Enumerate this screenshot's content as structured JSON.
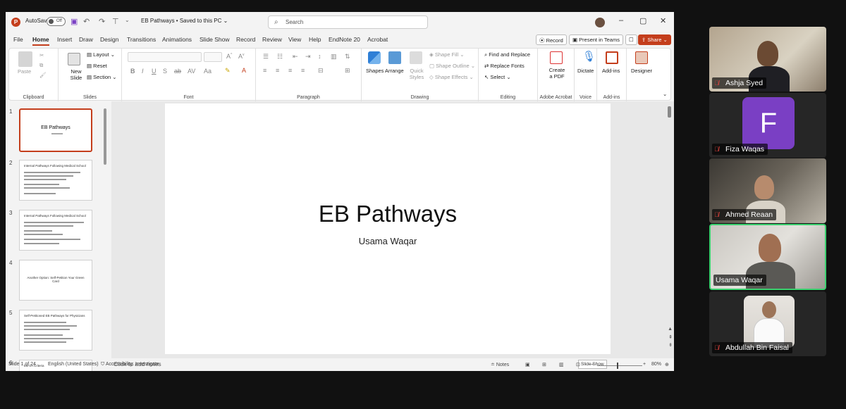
{
  "window": {
    "autosave_label": "AutoSave",
    "autosave_state": "Off",
    "doc_title": "EB Pathways • Saved to this PC ⌄",
    "search_placeholder": "Search"
  },
  "menu": {
    "tabs": [
      "File",
      "Home",
      "Insert",
      "Draw",
      "Design",
      "Transitions",
      "Animations",
      "Slide Show",
      "Record",
      "Review",
      "View",
      "Help",
      "EndNote 20",
      "Acrobat"
    ],
    "active_tab": "Home",
    "record_label": "Record",
    "present_label": "Present in Teams",
    "share_label": "Share"
  },
  "ribbon": {
    "clipboard": {
      "paste": "Paste",
      "label": "Clipboard"
    },
    "slides": {
      "new_slide": "New Slide",
      "layout": "Layout",
      "reset": "Reset",
      "section": "Section",
      "label": "Slides"
    },
    "font": {
      "label": "Font"
    },
    "paragraph": {
      "label": "Paragraph"
    },
    "drawing": {
      "shapes": "Shapes",
      "arrange": "Arrange",
      "quick_styles": "Quick Styles",
      "shape_fill": "Shape Fill",
      "shape_outline": "Shape Outline",
      "shape_effects": "Shape Effects",
      "label": "Drawing"
    },
    "editing": {
      "find_replace": "Find and Replace",
      "replace_fonts": "Replace Fonts",
      "select": "Select",
      "label": "Editing"
    },
    "acrobat": {
      "create_pdf": "Create a PDF",
      "label": "Adobe Acrobat"
    },
    "voice": {
      "dictate": "Dictate",
      "label": "Voice"
    },
    "addins": {
      "addins": "Add-ins",
      "label": "Add-ins"
    },
    "designer": {
      "designer": "Designer"
    }
  },
  "thumbnails": [
    {
      "num": "1",
      "title": "EB Pathways"
    },
    {
      "num": "2",
      "title": "Internal Pathways Following Medical School"
    },
    {
      "num": "3",
      "title": "Internal Pathways Following Medical School"
    },
    {
      "num": "4",
      "title": "Another Option: Self-Petition Your Green Card"
    },
    {
      "num": "5",
      "title": "Self-Petitioned EB Pathways for Physicians"
    },
    {
      "num": "6",
      "title": "EB-1A Criteria"
    }
  ],
  "slide": {
    "title": "EB Pathways",
    "subtitle": "Usama Waqar"
  },
  "notes": {
    "placeholder": "Click to add notes",
    "tooltip": "Slide Show"
  },
  "status": {
    "slide_count": "Slide 1 of 24",
    "language": "English (United States)",
    "accessibility": "Accessibility: Investigate",
    "notes_btn": "Notes",
    "zoom": "80%"
  },
  "participants": [
    {
      "name": "Ashja Syed",
      "muted": true
    },
    {
      "name": "Fiza Waqas",
      "muted": true,
      "initial": "F"
    },
    {
      "name": "Ahmed Reaan",
      "muted": true
    },
    {
      "name": "Usama Waqar",
      "muted": false
    },
    {
      "name": "Abdullah Bin Faisal",
      "muted": true
    }
  ],
  "colors": {
    "ppt_accent": "#c43e1c",
    "active_speaker": "#3bd16f",
    "avatar_purple": "#7a3fc4"
  }
}
